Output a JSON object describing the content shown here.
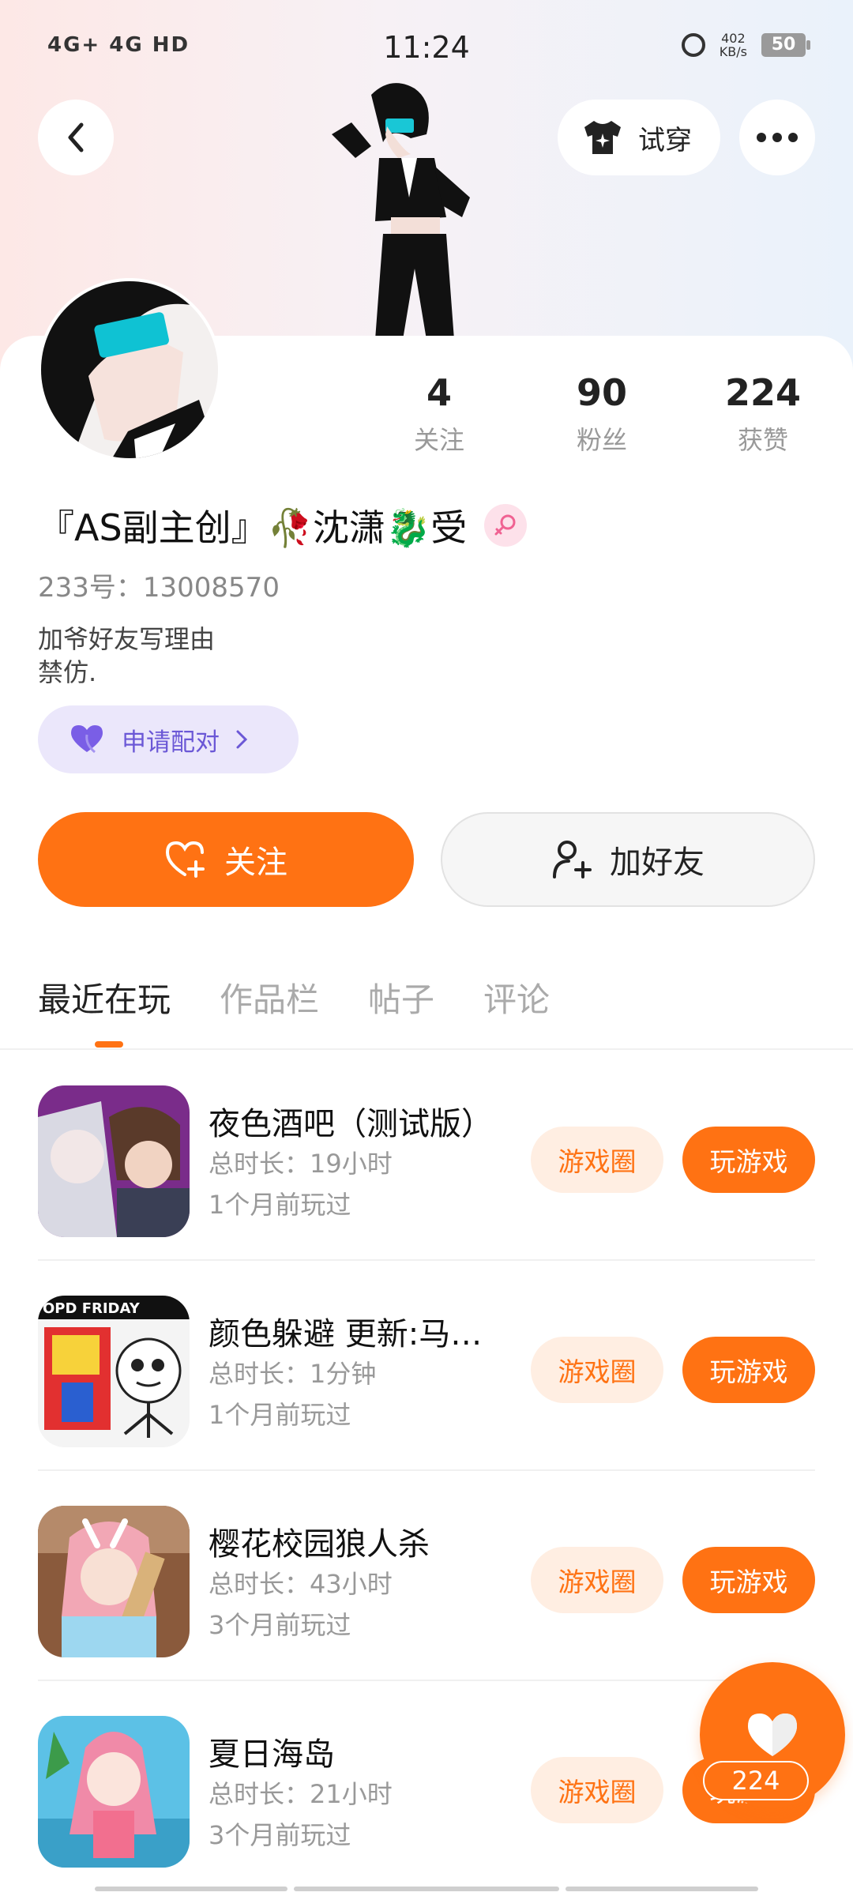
{
  "status_bar": {
    "signal_text": "4G+ 4G HD",
    "time": "11:24",
    "net_speed_value": "402",
    "net_speed_unit": "KB/s",
    "battery": "50"
  },
  "header": {
    "try_on_label": "试穿"
  },
  "profile": {
    "stats": [
      {
        "value": "4",
        "label": "关注"
      },
      {
        "value": "90",
        "label": "粉丝"
      },
      {
        "value": "224",
        "label": "获赞"
      }
    ],
    "name": "『AS副主创』🥀沈潇🐉受",
    "id_text": "233号：13008570",
    "bio_line1": "加爷好友写理由",
    "bio_line2": "禁仿.",
    "pair_label": "申请配对"
  },
  "actions": {
    "follow_label": "关注",
    "add_friend_label": "加好友"
  },
  "tabs": [
    {
      "label": "最近在玩",
      "active": true
    },
    {
      "label": "作品栏",
      "active": false
    },
    {
      "label": "帖子",
      "active": false
    },
    {
      "label": "评论",
      "active": false
    }
  ],
  "games": [
    {
      "title": "夜色酒吧（测试版）",
      "duration": "总时长：19小时",
      "last_played": "1个月前玩过",
      "circle_label": "游戏圈",
      "play_label": "玩游戏"
    },
    {
      "title": "颜色躲避 更新:马…",
      "duration": "总时长：1分钟",
      "last_played": "1个月前玩过",
      "circle_label": "游戏圈",
      "play_label": "玩游戏",
      "icon_text": "OPD FRIDAY"
    },
    {
      "title": "樱花校园狼人杀",
      "duration": "总时长：43小时",
      "last_played": "3个月前玩过",
      "circle_label": "游戏圈",
      "play_label": "玩游戏"
    },
    {
      "title": "夏日海岛",
      "duration": "总时长：21小时",
      "last_played": "3个月前玩过",
      "circle_label": "游戏圈",
      "play_label": "玩游戏"
    }
  ],
  "fab": {
    "like_count": "224"
  },
  "colors": {
    "accent": "#ff7213",
    "accent_light": "#ffeee2",
    "pair_bg": "#ebe7fb",
    "pair_text": "#6b58d6"
  }
}
